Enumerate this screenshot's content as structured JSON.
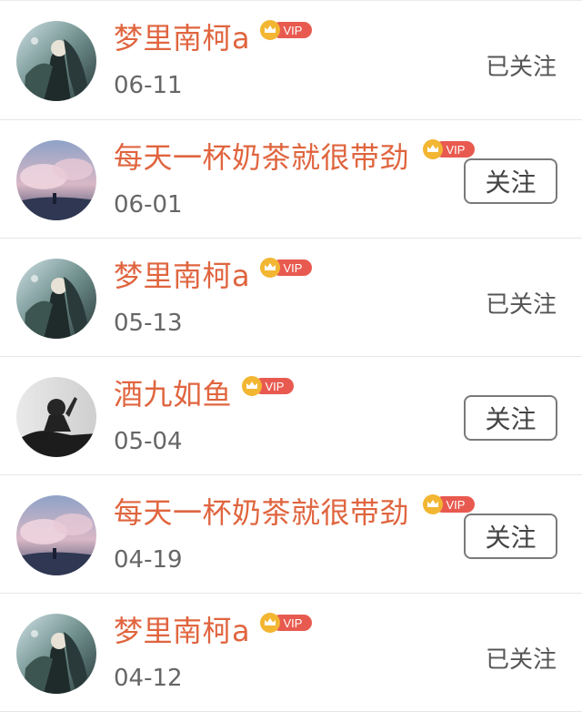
{
  "rows": [
    {
      "name": "梦里南柯a",
      "badge": "VIP",
      "date": "06-11",
      "status": "已关注",
      "avatar": "anime-avatar-icon"
    },
    {
      "name": "每天一杯奶茶就很带劲",
      "badge": "VIP",
      "date": "06-01",
      "status": "关注",
      "avatar": "sky-avatar-icon"
    },
    {
      "name": "梦里南柯a",
      "badge": "VIP",
      "date": "05-13",
      "status": "已关注",
      "avatar": "anime-avatar-icon"
    },
    {
      "name": "酒九如鱼",
      "badge": "VIP",
      "date": "05-04",
      "status": "关注",
      "avatar": "silhouette-avatar-icon"
    },
    {
      "name": "每天一杯奶茶就很带劲",
      "badge": "VIP",
      "date": "04-19",
      "status": "关注",
      "avatar": "sky-avatar-icon"
    },
    {
      "name": "梦里南柯a",
      "badge": "VIP",
      "date": "04-12",
      "status": "已关注",
      "avatar": "anime-avatar-icon"
    }
  ],
  "colors": {
    "name": "#e0653f",
    "vip_badge": "#e85a4f",
    "crown": "#f2b632",
    "date": "#666666"
  }
}
